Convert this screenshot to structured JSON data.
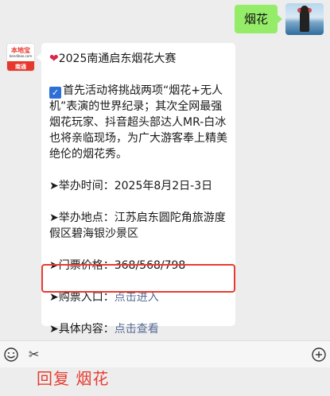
{
  "user_message": "烟花",
  "bot": {
    "brand": "本地宝",
    "domain": "bendibao.com",
    "city": "南通"
  },
  "reply": {
    "title": "2025南通启东烟花大赛",
    "intro": "首先活动将挑战两项“烟花+无人机”表演的世界纪录；其次全网最强烟花玩家、抖音超头部达人MR-白冰也将亲临现场，为广大游客奉上精美绝伦的烟花秀。",
    "time_label": "➤举办时间：",
    "time_value": "2025年8月2日-3日",
    "location_label": "➤举办地点：",
    "location_value": "江苏启东圆陀角旅游度假区碧海银沙景区",
    "price_label": "➤门票价格：",
    "price_value": "368/568/798",
    "ticket_label": "➤购票入口：",
    "ticket_link": "点击进入",
    "details_label": "➤具体内容：",
    "details_link": "点击查看"
  },
  "caption": "回复 烟花",
  "colors": {
    "outgoing_bubble": "#95ec69",
    "link": "#576b95",
    "highlight": "#e63c30"
  },
  "icons": {
    "emoji": "emoji-icon",
    "scissors": "scissors-icon",
    "plus": "plus-icon"
  }
}
